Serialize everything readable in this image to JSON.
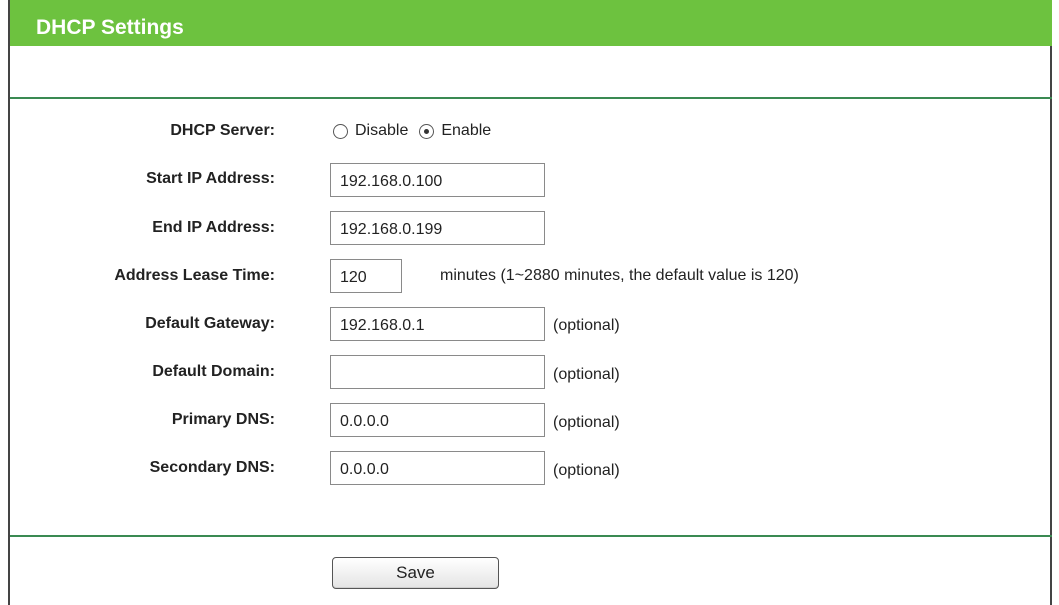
{
  "header": {
    "title": "DHCP Settings"
  },
  "dhcp_server": {
    "label": "DHCP Server:",
    "options": [
      {
        "label": "Disable",
        "checked": false
      },
      {
        "label": "Enable",
        "checked": true
      }
    ]
  },
  "fields": [
    {
      "label": "Start IP Address:",
      "value": "192.168.0.100",
      "note": ""
    },
    {
      "label": "End IP Address:",
      "value": "192.168.0.199",
      "note": ""
    },
    {
      "label": "Address Lease Time:",
      "value": "120",
      "note": "minutes (1~2880 minutes, the default value is 120)"
    },
    {
      "label": "Default Gateway:",
      "value": "192.168.0.1",
      "note": "(optional)"
    },
    {
      "label": "Default Domain:",
      "value": "",
      "note": "(optional)"
    },
    {
      "label": "Primary DNS:",
      "value": "0.0.0.0",
      "note": "(optional)"
    },
    {
      "label": "Secondary DNS:",
      "value": "0.0.0.0",
      "note": "(optional)"
    }
  ],
  "save_button": {
    "label": "Save"
  }
}
